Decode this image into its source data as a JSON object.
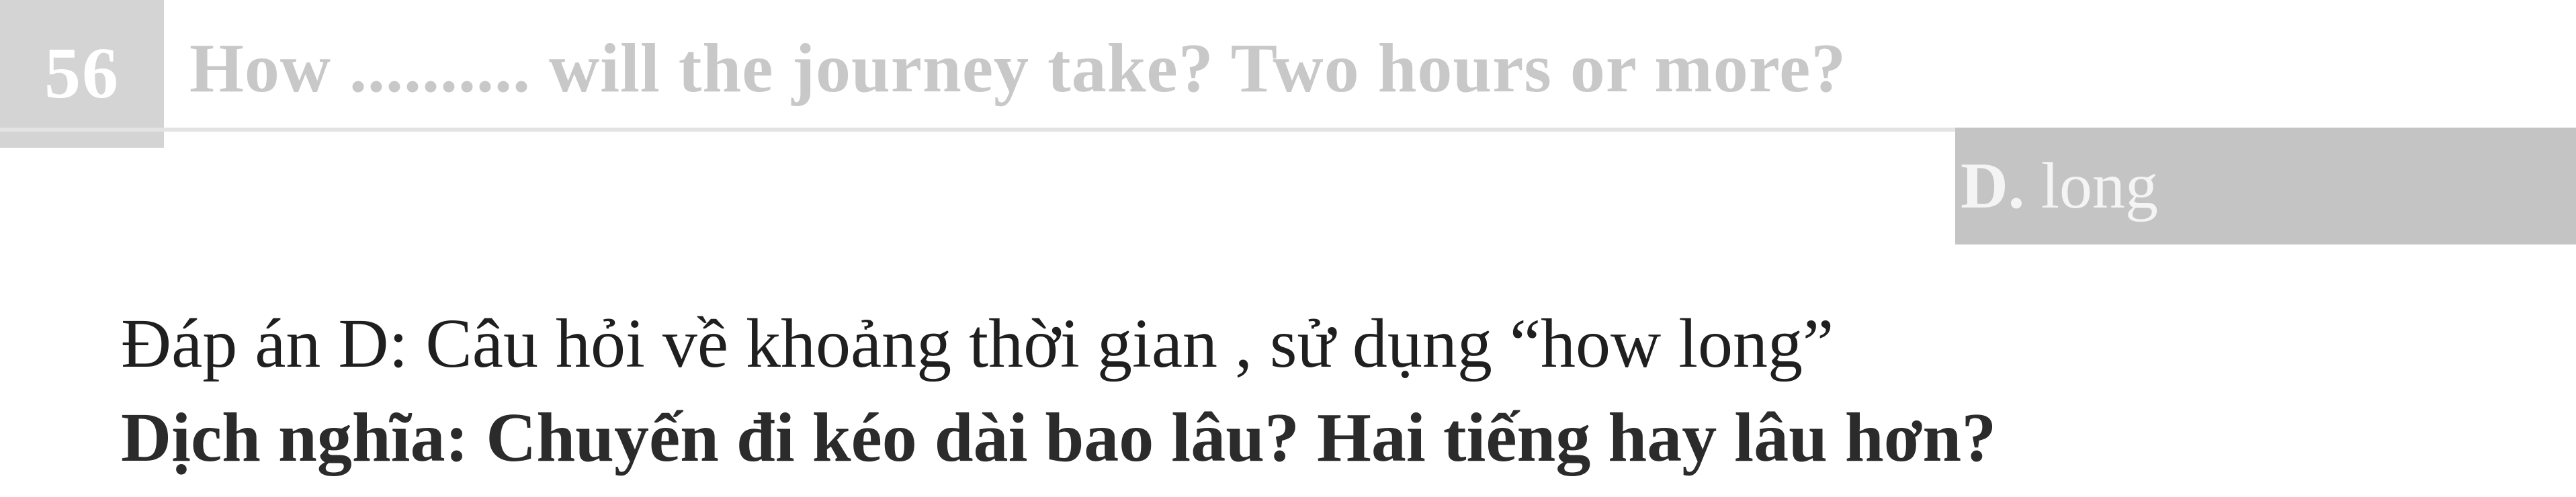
{
  "question": {
    "number": "56",
    "text": "How .......... will the journey take? Two hours or more?"
  },
  "answer_option": {
    "letter": "D.",
    "text": "long"
  },
  "explanation": "Đáp án D: Câu hỏi về khoảng thời gian , sử dụng “how long”",
  "translation": "Dịch nghĩa: Chuyến đi kéo dài bao lâu? Hai tiếng hay lâu hơn?",
  "colors": {
    "number_background": "#d4d4d4",
    "question_text": "#c8c8c8",
    "answer_band": "#c4c4c4",
    "explanation_text": "#1f1f1f"
  }
}
